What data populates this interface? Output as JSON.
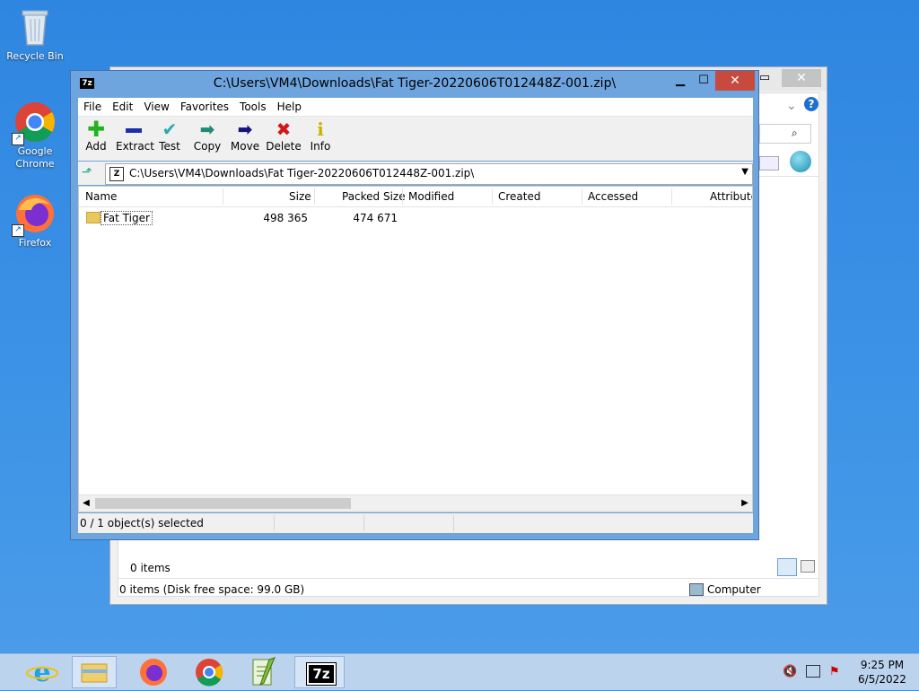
{
  "desktop": {
    "icons": [
      {
        "label": "Recycle Bin"
      },
      {
        "label": "Google Chrome"
      },
      {
        "label": "Firefox"
      }
    ]
  },
  "window": {
    "title": "C:\\Users\\VM4\\Downloads\\Fat Tiger-20220606T012448Z-001.zip\\",
    "app_logo": "7z",
    "menu": [
      "File",
      "Edit",
      "View",
      "Favorites",
      "Tools",
      "Help"
    ],
    "toolbar": [
      {
        "label": "Add",
        "icon": "plus-icon",
        "color": "#22b21f"
      },
      {
        "label": "Extract",
        "icon": "minus-icon",
        "color": "#1b2fa8"
      },
      {
        "label": "Test",
        "icon": "check-icon",
        "color": "#29a8b5"
      },
      {
        "label": "Copy",
        "icon": "arrow-right-icon",
        "color": "#1f8a7a"
      },
      {
        "label": "Move",
        "icon": "arrow-right-icon",
        "color": "#14147a"
      },
      {
        "label": "Delete",
        "icon": "x-icon",
        "color": "#d11717"
      },
      {
        "label": "Info",
        "icon": "info-icon",
        "color": "#c8b400"
      }
    ],
    "address": "C:\\Users\\VM4\\Downloads\\Fat Tiger-20220606T012448Z-001.zip\\",
    "columns": [
      "Name",
      "Size",
      "Packed Size",
      "Modified",
      "Created",
      "Accessed",
      "Attribute"
    ],
    "rows": [
      {
        "name": "Fat Tiger",
        "size": "498 365",
        "packed": "474 671"
      }
    ],
    "status": "0 / 1 object(s) selected"
  },
  "bg_window": {
    "items_count": "0 items",
    "status": "0 items (Disk free space: 99.0 GB)",
    "location": "Computer"
  },
  "taskbar": {
    "clock_time": "9:25 PM",
    "clock_date": "6/5/2022",
    "active_app": "7z"
  }
}
